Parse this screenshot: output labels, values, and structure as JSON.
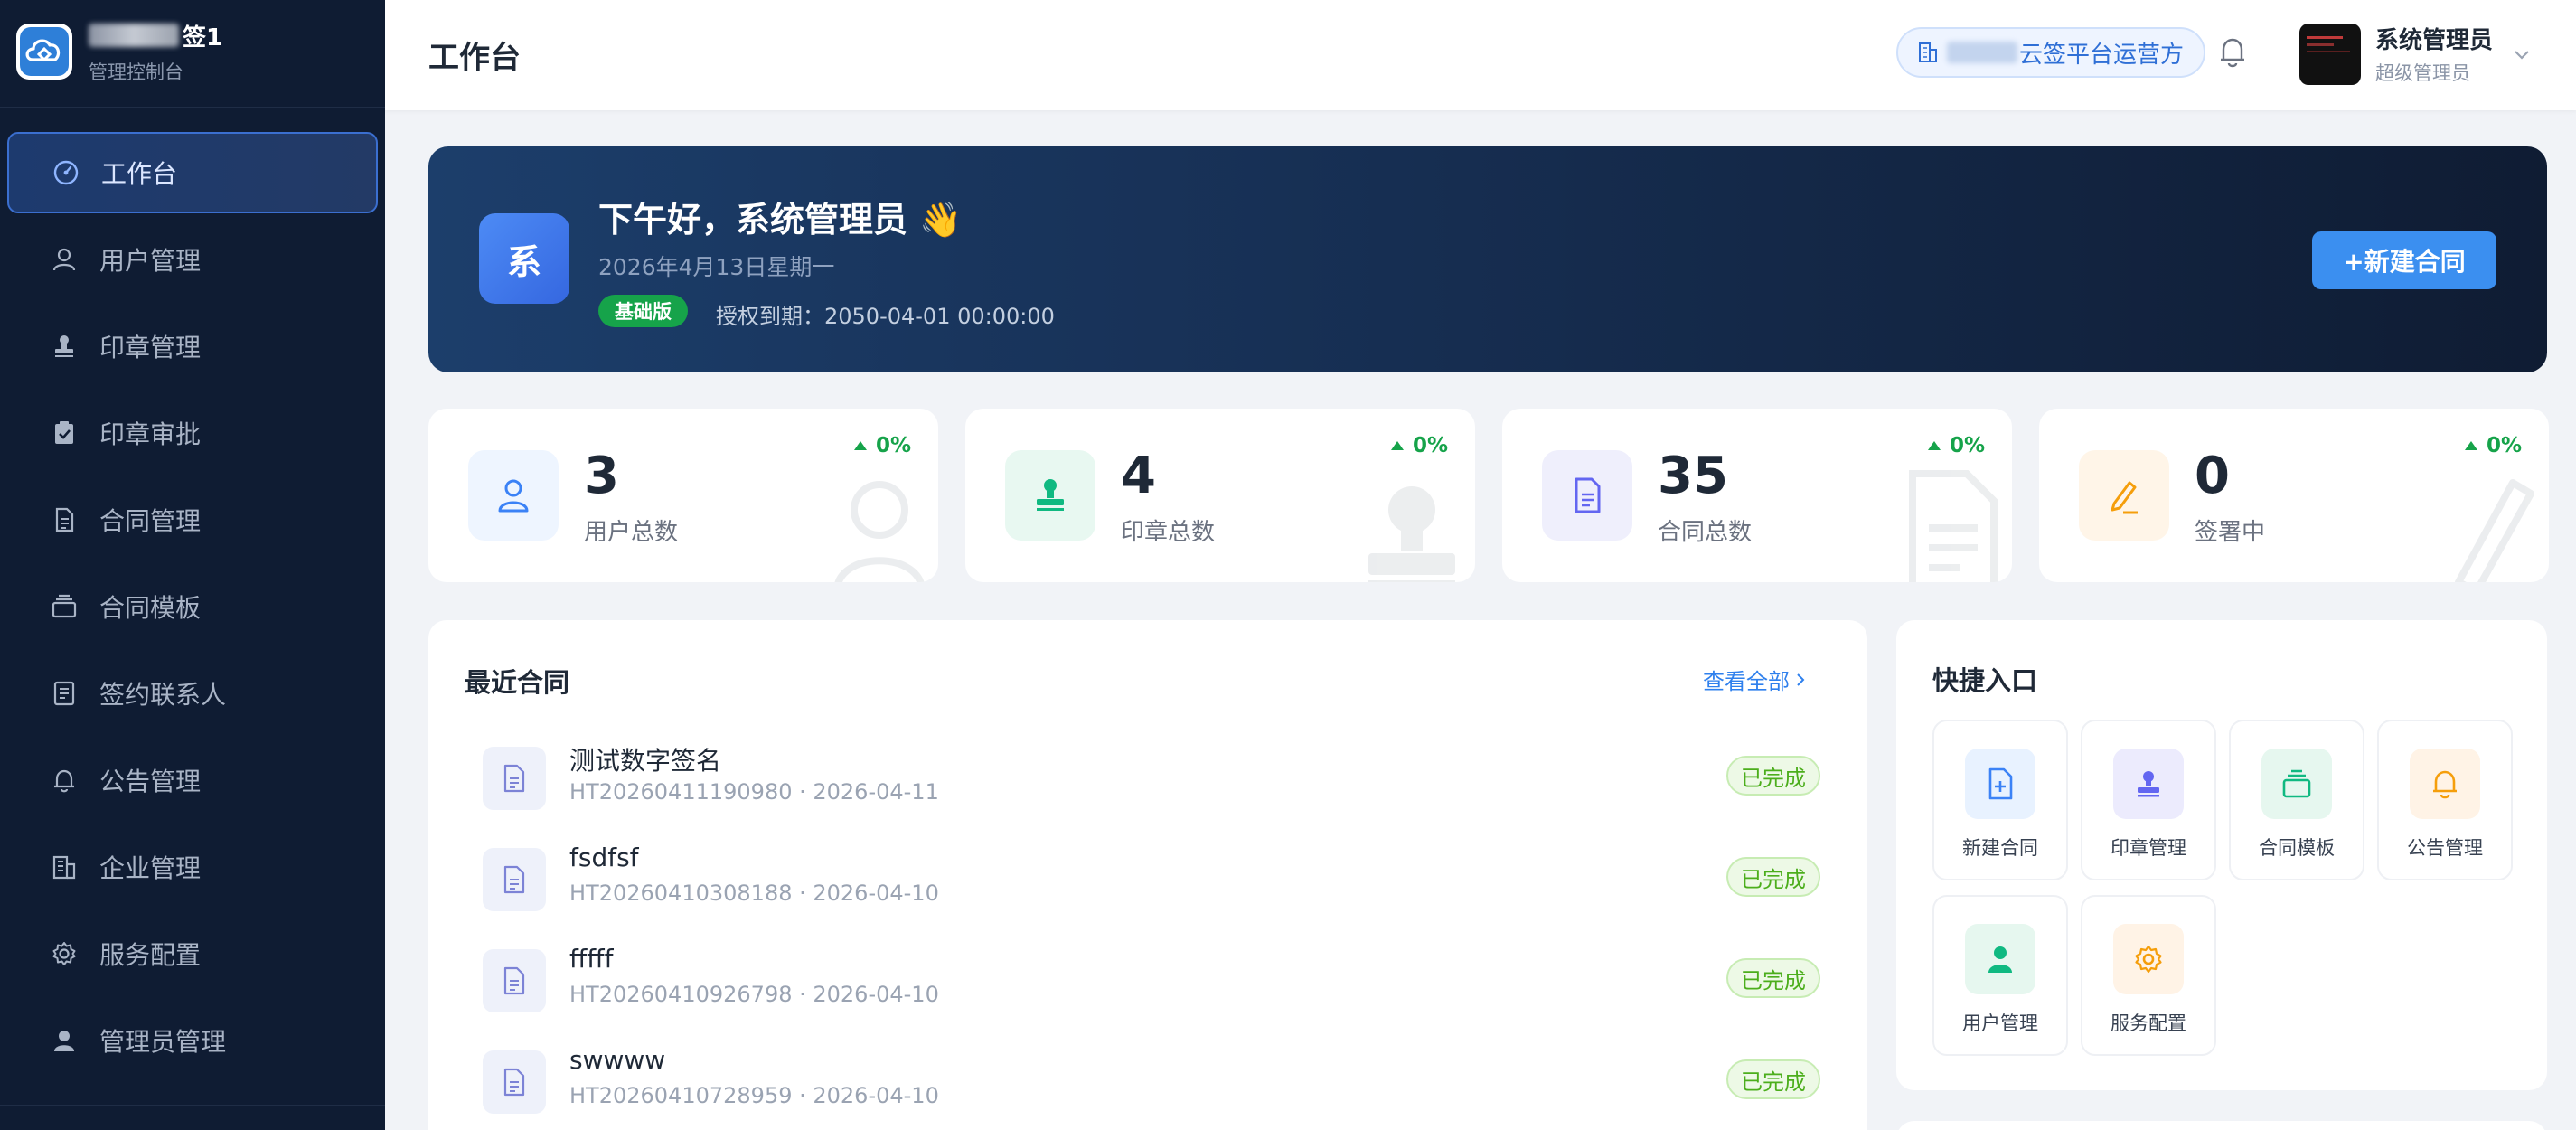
{
  "sidebar": {
    "brand_name_suffix": "签1",
    "brand_sub": "管理控制台",
    "items": [
      {
        "label": "工作台",
        "icon": "dashboard-icon"
      },
      {
        "label": "用户管理",
        "icon": "user-icon"
      },
      {
        "label": "印章管理",
        "icon": "stamp-icon"
      },
      {
        "label": "印章审批",
        "icon": "clipboard-check-icon"
      },
      {
        "label": "合同管理",
        "icon": "document-icon"
      },
      {
        "label": "合同模板",
        "icon": "template-icon"
      },
      {
        "label": "签约联系人",
        "icon": "contacts-icon"
      },
      {
        "label": "公告管理",
        "icon": "bell-icon"
      },
      {
        "label": "企业管理",
        "icon": "building-icon"
      },
      {
        "label": "服务配置",
        "icon": "gear-icon"
      },
      {
        "label": "管理员管理",
        "icon": "admin-icon"
      }
    ]
  },
  "header": {
    "title": "工作台",
    "tenant_suffix": "云签平台运营方",
    "user_name": "系统管理员",
    "user_role": "超级管理员"
  },
  "banner": {
    "avatar_char": "系",
    "greeting": "下午好，系统管理员 👋",
    "date": "2026年4月13日星期一",
    "plan": "基础版",
    "expire": "授权到期：2050-04-01 00:00:00",
    "new_button": "+新建合同"
  },
  "stats": [
    {
      "value": "3",
      "label": "用户总数",
      "trend": "0%",
      "icon": "user-icon",
      "color": "#3b82f6"
    },
    {
      "value": "4",
      "label": "印章总数",
      "trend": "0%",
      "icon": "stamp-icon",
      "color": "#10b981"
    },
    {
      "value": "35",
      "label": "合同总数",
      "trend": "0%",
      "icon": "document-icon",
      "color": "#6366f1"
    },
    {
      "value": "0",
      "label": "签署中",
      "trend": "0%",
      "icon": "pen-icon",
      "color": "#f59e0b"
    }
  ],
  "recent": {
    "title": "最近合同",
    "view_all": "查看全部",
    "rows": [
      {
        "name": "测试数字签名",
        "meta": "HT20260411190980 · 2026-04-11",
        "status": "已完成"
      },
      {
        "name": "fsdfsf",
        "meta": "HT20260410308188 · 2026-04-10",
        "status": "已完成"
      },
      {
        "name": "fffff",
        "meta": "HT20260410926798 · 2026-04-10",
        "status": "已完成"
      },
      {
        "name": "swwww",
        "meta": "HT20260410728959 · 2026-04-10",
        "status": "已完成"
      }
    ]
  },
  "quick": {
    "title": "快捷入口",
    "tiles": [
      {
        "label": "新建合同",
        "icon": "file-plus-icon"
      },
      {
        "label": "印章管理",
        "icon": "stamp-icon"
      },
      {
        "label": "合同模板",
        "icon": "template-icon"
      },
      {
        "label": "公告管理",
        "icon": "bell-icon"
      },
      {
        "label": "用户管理",
        "icon": "user-icon"
      },
      {
        "label": "服务配置",
        "icon": "gear-icon"
      }
    ]
  },
  "colors": {
    "sidebar_bg": "#0f1c33",
    "accent": "#3b8ff0",
    "success": "#4cae1c"
  }
}
